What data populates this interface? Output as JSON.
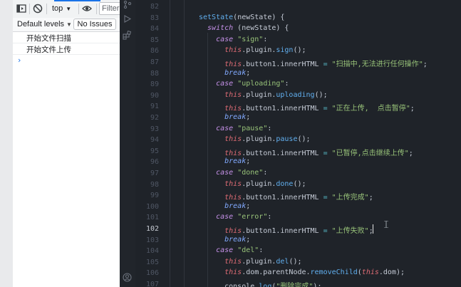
{
  "console": {
    "toolbar": {
      "context": "top",
      "filter_placeholder": "Filter"
    },
    "levels_label": "Default levels",
    "no_issues_label": "No Issues",
    "logs": [
      "开始文件扫描",
      "开始文件上传"
    ],
    "prompt": "›"
  },
  "editor": {
    "active_line": 102,
    "lines": [
      {
        "n": 82,
        "i": 0,
        "t": []
      },
      {
        "n": 83,
        "i": 0,
        "t": [
          [
            "fn",
            "setState"
          ],
          [
            "p",
            "("
          ],
          [
            "p",
            "newState"
          ],
          [
            "p",
            ") {"
          ]
        ]
      },
      {
        "n": 84,
        "i": 1,
        "t": [
          [
            "kw",
            "switch"
          ],
          [
            "p",
            " (newState) {"
          ]
        ]
      },
      {
        "n": 85,
        "i": 2,
        "t": [
          [
            "kw",
            "case"
          ],
          [
            "p",
            " "
          ],
          [
            "str",
            "\"sign\""
          ],
          [
            "p",
            ":"
          ]
        ]
      },
      {
        "n": 86,
        "i": 3,
        "t": [
          [
            "ths",
            "this"
          ],
          [
            "p",
            ".plugin."
          ],
          [
            "fn",
            "sign"
          ],
          [
            "p",
            "();"
          ]
        ]
      },
      {
        "n": 87,
        "i": 3,
        "t": [
          [
            "ths",
            "this"
          ],
          [
            "p",
            ".button1.innerHTML "
          ],
          [
            "op",
            "="
          ],
          [
            "p",
            " "
          ],
          [
            "str",
            "\"扫描中,无法进行任何操作\""
          ],
          [
            "p",
            ";"
          ]
        ]
      },
      {
        "n": 88,
        "i": 3,
        "t": [
          [
            "brk",
            "break"
          ],
          [
            "p",
            ";"
          ]
        ]
      },
      {
        "n": 89,
        "i": 2,
        "t": [
          [
            "kw",
            "case"
          ],
          [
            "p",
            " "
          ],
          [
            "str",
            "\"uploading\""
          ],
          [
            "p",
            ":"
          ]
        ]
      },
      {
        "n": 90,
        "i": 3,
        "t": [
          [
            "ths",
            "this"
          ],
          [
            "p",
            ".plugin."
          ],
          [
            "fn",
            "uploading"
          ],
          [
            "p",
            "();"
          ]
        ]
      },
      {
        "n": 91,
        "i": 3,
        "t": [
          [
            "ths",
            "this"
          ],
          [
            "p",
            ".button1.innerHTML "
          ],
          [
            "op",
            "="
          ],
          [
            "p",
            " "
          ],
          [
            "str",
            "\"正在上传,  点击暂停\""
          ],
          [
            "p",
            ";"
          ]
        ]
      },
      {
        "n": 92,
        "i": 3,
        "t": [
          [
            "brk",
            "break"
          ],
          [
            "p",
            ";"
          ]
        ]
      },
      {
        "n": 93,
        "i": 2,
        "t": [
          [
            "kw",
            "case"
          ],
          [
            "p",
            " "
          ],
          [
            "str",
            "\"pause\""
          ],
          [
            "p",
            ":"
          ]
        ]
      },
      {
        "n": 94,
        "i": 3,
        "t": [
          [
            "ths",
            "this"
          ],
          [
            "p",
            ".plugin."
          ],
          [
            "fn",
            "pause"
          ],
          [
            "p",
            "();"
          ]
        ]
      },
      {
        "n": 95,
        "i": 3,
        "t": [
          [
            "ths",
            "this"
          ],
          [
            "p",
            ".button1.innerHTML "
          ],
          [
            "op",
            "="
          ],
          [
            "p",
            " "
          ],
          [
            "str",
            "\"已暂停,点击继续上传\""
          ],
          [
            "p",
            ";"
          ]
        ]
      },
      {
        "n": 96,
        "i": 3,
        "t": [
          [
            "brk",
            "break"
          ],
          [
            "p",
            ";"
          ]
        ]
      },
      {
        "n": 97,
        "i": 2,
        "t": [
          [
            "kw",
            "case"
          ],
          [
            "p",
            " "
          ],
          [
            "str",
            "\"done\""
          ],
          [
            "p",
            ":"
          ]
        ]
      },
      {
        "n": 98,
        "i": 3,
        "t": [
          [
            "ths",
            "this"
          ],
          [
            "p",
            ".plugin."
          ],
          [
            "fn",
            "done"
          ],
          [
            "p",
            "();"
          ]
        ]
      },
      {
        "n": 99,
        "i": 3,
        "t": [
          [
            "ths",
            "this"
          ],
          [
            "p",
            ".button1.innerHTML "
          ],
          [
            "op",
            "="
          ],
          [
            "p",
            " "
          ],
          [
            "str",
            "\"上传完成\""
          ],
          [
            "p",
            ";"
          ]
        ]
      },
      {
        "n": 100,
        "i": 3,
        "t": [
          [
            "brk",
            "break"
          ],
          [
            "p",
            ";"
          ]
        ]
      },
      {
        "n": 101,
        "i": 2,
        "t": [
          [
            "kw",
            "case"
          ],
          [
            "p",
            " "
          ],
          [
            "str",
            "\"error\""
          ],
          [
            "p",
            ":"
          ]
        ]
      },
      {
        "n": 102,
        "i": 3,
        "t": [
          [
            "ths",
            "this"
          ],
          [
            "p",
            ".button1.innerHTML "
          ],
          [
            "op",
            "="
          ],
          [
            "p",
            " "
          ],
          [
            "str",
            "\"上传失败\""
          ],
          [
            "p",
            ";"
          ]
        ]
      },
      {
        "n": 103,
        "i": 3,
        "t": [
          [
            "brk",
            "break"
          ],
          [
            "p",
            ";"
          ]
        ]
      },
      {
        "n": 104,
        "i": 2,
        "t": [
          [
            "kw",
            "case"
          ],
          [
            "p",
            " "
          ],
          [
            "str",
            "\"del\""
          ],
          [
            "p",
            ":"
          ]
        ]
      },
      {
        "n": 105,
        "i": 3,
        "t": [
          [
            "ths",
            "this"
          ],
          [
            "p",
            ".plugin."
          ],
          [
            "fn",
            "del"
          ],
          [
            "p",
            "();"
          ]
        ]
      },
      {
        "n": 106,
        "i": 3,
        "t": [
          [
            "ths",
            "this"
          ],
          [
            "p",
            ".dom.parentNode."
          ],
          [
            "fn",
            "removeChild"
          ],
          [
            "p",
            "("
          ],
          [
            "ths",
            "this"
          ],
          [
            "p",
            ".dom);"
          ]
        ]
      },
      {
        "n": 107,
        "i": 3,
        "t": [
          [
            "p",
            "console."
          ],
          [
            "fn",
            "log"
          ],
          [
            "p",
            "("
          ],
          [
            "str",
            "\"删除完成\""
          ],
          [
            "p",
            ");"
          ]
        ]
      }
    ]
  },
  "colors": {
    "editor_bg": "#1f2329",
    "keyword": "#c792ea",
    "function": "#61afef",
    "string": "#98c379",
    "this": "#e06c75",
    "accent": "#1a73e8"
  }
}
